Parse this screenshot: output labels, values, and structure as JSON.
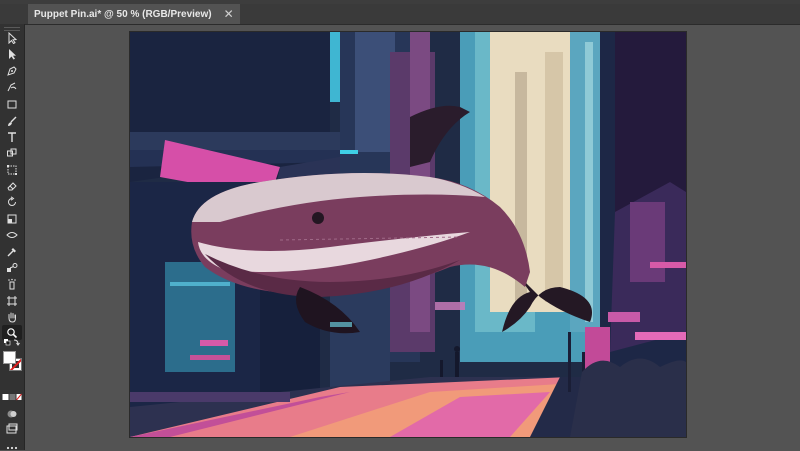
{
  "document": {
    "tab_title": "Puppet Pin.ai* @ 50 % (RGB/Preview)",
    "close_glyph": "✕"
  },
  "toolbar": {
    "tools": [
      {
        "name": "selection-tool",
        "icon": "arrow-icon"
      },
      {
        "name": "direct-selection-tool",
        "icon": "hollow-arrow-icon"
      },
      {
        "name": "pen-tool",
        "icon": "pen-icon"
      },
      {
        "name": "curvature-tool",
        "icon": "curvature-pen-icon"
      },
      {
        "name": "rectangle-tool",
        "icon": "rectangle-icon"
      },
      {
        "name": "paintbrush-tool",
        "icon": "brush-icon"
      },
      {
        "name": "type-tool",
        "icon": "type-icon",
        "glyph": "T"
      },
      {
        "name": "shape-builder-tool",
        "icon": "shape-builder-icon"
      },
      {
        "name": "free-transform-tool",
        "icon": "free-transform-icon"
      },
      {
        "name": "eraser-tool",
        "icon": "eraser-icon"
      },
      {
        "name": "rotate-tool",
        "icon": "rotate-icon"
      },
      {
        "name": "scale-tool",
        "icon": "scale-icon"
      },
      {
        "name": "width-tool",
        "icon": "width-icon"
      },
      {
        "name": "eyedropper-tool",
        "icon": "eyedropper-icon"
      },
      {
        "name": "blend-tool",
        "icon": "blend-icon"
      },
      {
        "name": "symbol-sprayer-tool",
        "icon": "spray-icon"
      },
      {
        "name": "artboard-tool",
        "icon": "artboard-icon"
      },
      {
        "name": "hand-tool",
        "icon": "hand-icon"
      },
      {
        "name": "zoom-tool",
        "icon": "zoom-icon",
        "active": true
      }
    ],
    "fill_color": "#ffffff",
    "stroke_color": "none"
  },
  "colors": {
    "app_bg": "#535353",
    "panel_bg": "#323232",
    "tab_active": "#535353",
    "accent_pink": "#c85aa8",
    "whale_body": "#7a3d5e"
  }
}
